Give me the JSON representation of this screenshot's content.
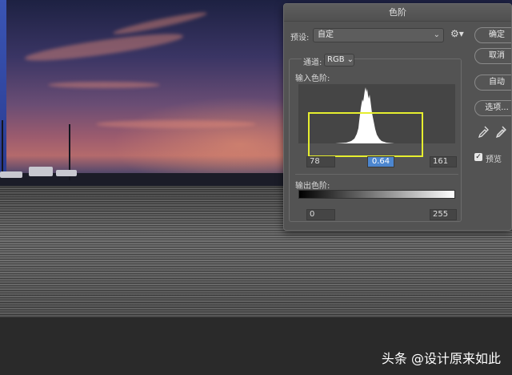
{
  "dialog": {
    "title": "色阶",
    "preset_label": "预设:",
    "preset_value": "自定",
    "channel_label": "通道:",
    "channel_value": "RGB",
    "input_levels_label": "输入色阶:",
    "input_black": "78",
    "input_gamma": "0.64",
    "input_white": "161",
    "output_levels_label": "输出色阶:",
    "output_black": "0",
    "output_white": "255",
    "buttons": {
      "ok": "确定",
      "cancel": "取消",
      "auto": "自动",
      "options": "选项..."
    },
    "preview_label": "预览",
    "preview_checked": true,
    "highlight_color": "#e6ee2f"
  },
  "watermark": "头条 @设计原来如此"
}
